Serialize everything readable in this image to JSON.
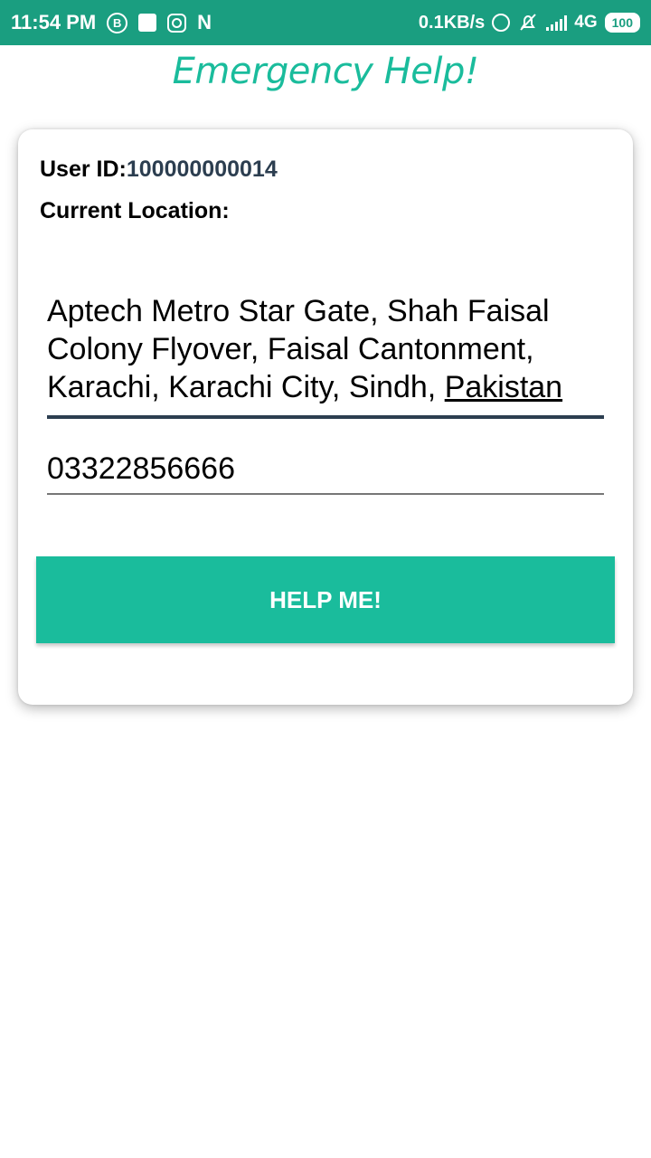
{
  "status_bar": {
    "time": "11:54 PM",
    "speed": "0.1KB/s",
    "network": "4G",
    "battery": "100",
    "left_icons": [
      "b-notification-icon",
      "app-notification-icon",
      "instagram-icon",
      "n-notification-icon"
    ],
    "right_icons": [
      "hotspot-icon",
      "bell-off-icon",
      "signal-icon"
    ]
  },
  "header": {
    "title": "Emergency Help!"
  },
  "card": {
    "user_id_label": "User ID:",
    "user_id_value": "100000000014",
    "location_label": "Current Location:",
    "address_main": "Aptech Metro Star Gate, Shah Faisal Colony Flyover, Faisal Cantonment, Karachi, Karachi City, Sindh, ",
    "address_last": "Pakistan",
    "phone": "03322856666",
    "button_label": "HELP ME!"
  },
  "colors": {
    "status_bar": "#1a9e80",
    "accent": "#1abc9c",
    "dark_text": "#2c3e50"
  }
}
